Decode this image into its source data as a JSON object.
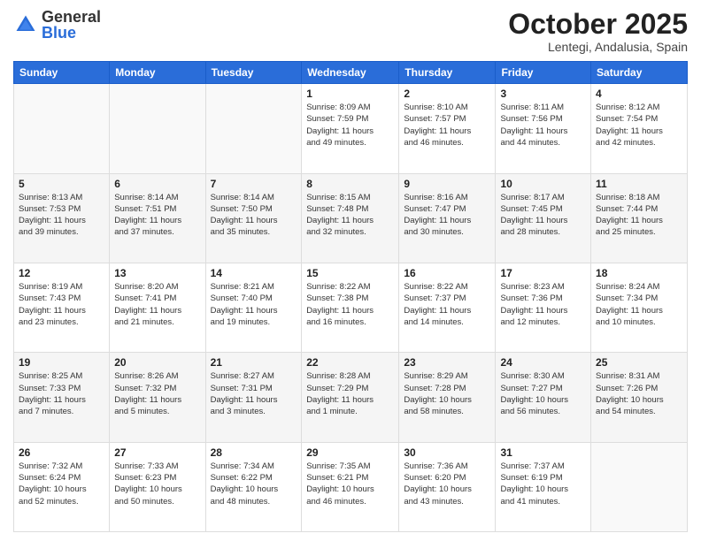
{
  "header": {
    "logo_general": "General",
    "logo_blue": "Blue",
    "month": "October 2025",
    "location": "Lentegi, Andalusia, Spain"
  },
  "weekdays": [
    "Sunday",
    "Monday",
    "Tuesday",
    "Wednesday",
    "Thursday",
    "Friday",
    "Saturday"
  ],
  "weeks": [
    [
      {
        "num": "",
        "info": ""
      },
      {
        "num": "",
        "info": ""
      },
      {
        "num": "",
        "info": ""
      },
      {
        "num": "1",
        "info": "Sunrise: 8:09 AM\nSunset: 7:59 PM\nDaylight: 11 hours\nand 49 minutes."
      },
      {
        "num": "2",
        "info": "Sunrise: 8:10 AM\nSunset: 7:57 PM\nDaylight: 11 hours\nand 46 minutes."
      },
      {
        "num": "3",
        "info": "Sunrise: 8:11 AM\nSunset: 7:56 PM\nDaylight: 11 hours\nand 44 minutes."
      },
      {
        "num": "4",
        "info": "Sunrise: 8:12 AM\nSunset: 7:54 PM\nDaylight: 11 hours\nand 42 minutes."
      }
    ],
    [
      {
        "num": "5",
        "info": "Sunrise: 8:13 AM\nSunset: 7:53 PM\nDaylight: 11 hours\nand 39 minutes."
      },
      {
        "num": "6",
        "info": "Sunrise: 8:14 AM\nSunset: 7:51 PM\nDaylight: 11 hours\nand 37 minutes."
      },
      {
        "num": "7",
        "info": "Sunrise: 8:14 AM\nSunset: 7:50 PM\nDaylight: 11 hours\nand 35 minutes."
      },
      {
        "num": "8",
        "info": "Sunrise: 8:15 AM\nSunset: 7:48 PM\nDaylight: 11 hours\nand 32 minutes."
      },
      {
        "num": "9",
        "info": "Sunrise: 8:16 AM\nSunset: 7:47 PM\nDaylight: 11 hours\nand 30 minutes."
      },
      {
        "num": "10",
        "info": "Sunrise: 8:17 AM\nSunset: 7:45 PM\nDaylight: 11 hours\nand 28 minutes."
      },
      {
        "num": "11",
        "info": "Sunrise: 8:18 AM\nSunset: 7:44 PM\nDaylight: 11 hours\nand 25 minutes."
      }
    ],
    [
      {
        "num": "12",
        "info": "Sunrise: 8:19 AM\nSunset: 7:43 PM\nDaylight: 11 hours\nand 23 minutes."
      },
      {
        "num": "13",
        "info": "Sunrise: 8:20 AM\nSunset: 7:41 PM\nDaylight: 11 hours\nand 21 minutes."
      },
      {
        "num": "14",
        "info": "Sunrise: 8:21 AM\nSunset: 7:40 PM\nDaylight: 11 hours\nand 19 minutes."
      },
      {
        "num": "15",
        "info": "Sunrise: 8:22 AM\nSunset: 7:38 PM\nDaylight: 11 hours\nand 16 minutes."
      },
      {
        "num": "16",
        "info": "Sunrise: 8:22 AM\nSunset: 7:37 PM\nDaylight: 11 hours\nand 14 minutes."
      },
      {
        "num": "17",
        "info": "Sunrise: 8:23 AM\nSunset: 7:36 PM\nDaylight: 11 hours\nand 12 minutes."
      },
      {
        "num": "18",
        "info": "Sunrise: 8:24 AM\nSunset: 7:34 PM\nDaylight: 11 hours\nand 10 minutes."
      }
    ],
    [
      {
        "num": "19",
        "info": "Sunrise: 8:25 AM\nSunset: 7:33 PM\nDaylight: 11 hours\nand 7 minutes."
      },
      {
        "num": "20",
        "info": "Sunrise: 8:26 AM\nSunset: 7:32 PM\nDaylight: 11 hours\nand 5 minutes."
      },
      {
        "num": "21",
        "info": "Sunrise: 8:27 AM\nSunset: 7:31 PM\nDaylight: 11 hours\nand 3 minutes."
      },
      {
        "num": "22",
        "info": "Sunrise: 8:28 AM\nSunset: 7:29 PM\nDaylight: 11 hours\nand 1 minute."
      },
      {
        "num": "23",
        "info": "Sunrise: 8:29 AM\nSunset: 7:28 PM\nDaylight: 10 hours\nand 58 minutes."
      },
      {
        "num": "24",
        "info": "Sunrise: 8:30 AM\nSunset: 7:27 PM\nDaylight: 10 hours\nand 56 minutes."
      },
      {
        "num": "25",
        "info": "Sunrise: 8:31 AM\nSunset: 7:26 PM\nDaylight: 10 hours\nand 54 minutes."
      }
    ],
    [
      {
        "num": "26",
        "info": "Sunrise: 7:32 AM\nSunset: 6:24 PM\nDaylight: 10 hours\nand 52 minutes."
      },
      {
        "num": "27",
        "info": "Sunrise: 7:33 AM\nSunset: 6:23 PM\nDaylight: 10 hours\nand 50 minutes."
      },
      {
        "num": "28",
        "info": "Sunrise: 7:34 AM\nSunset: 6:22 PM\nDaylight: 10 hours\nand 48 minutes."
      },
      {
        "num": "29",
        "info": "Sunrise: 7:35 AM\nSunset: 6:21 PM\nDaylight: 10 hours\nand 46 minutes."
      },
      {
        "num": "30",
        "info": "Sunrise: 7:36 AM\nSunset: 6:20 PM\nDaylight: 10 hours\nand 43 minutes."
      },
      {
        "num": "31",
        "info": "Sunrise: 7:37 AM\nSunset: 6:19 PM\nDaylight: 10 hours\nand 41 minutes."
      },
      {
        "num": "",
        "info": ""
      }
    ]
  ]
}
